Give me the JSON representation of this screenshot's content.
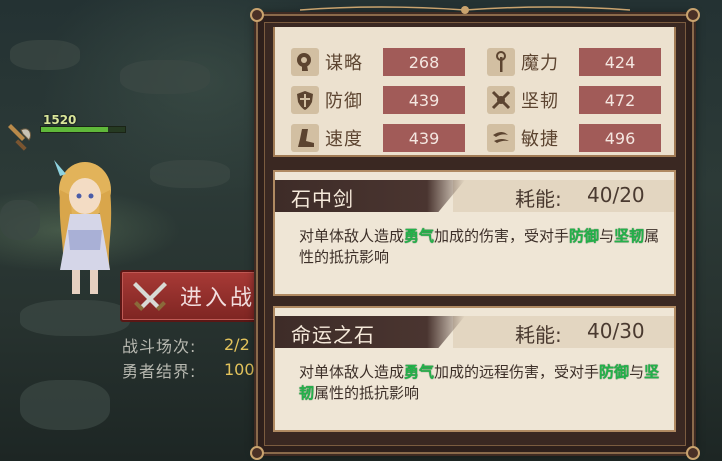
{
  "scene": {
    "hp_value": "1520",
    "hp_ratio": 0.8,
    "enter_button_label": "进入战",
    "battle_info": [
      {
        "label": "战斗场次:",
        "value": "2/2"
      },
      {
        "label": "勇者结界:",
        "value": "100"
      }
    ]
  },
  "stats": [
    {
      "icon": "scroll-head-icon",
      "name": "谋略",
      "value": "268"
    },
    {
      "icon": "staff-icon",
      "name": "魔力",
      "value": "424"
    },
    {
      "icon": "shield-icon",
      "name": "防御",
      "value": "439"
    },
    {
      "icon": "crossed-tools-icon",
      "name": "坚韧",
      "value": "472"
    },
    {
      "icon": "boot-icon",
      "name": "速度",
      "value": "439"
    },
    {
      "icon": "wind-icon",
      "name": "敏捷",
      "value": "496"
    }
  ],
  "skills": [
    {
      "name": "石中剑",
      "energy_label": "耗能:",
      "energy": "40/20",
      "desc_parts": [
        {
          "t": "对单体敌人造成",
          "hl": false
        },
        {
          "t": "勇气",
          "hl": true
        },
        {
          "t": "加成的伤害，受对手",
          "hl": false
        },
        {
          "t": "防御",
          "hl": true
        },
        {
          "t": "与",
          "hl": false
        },
        {
          "t": "坚韧",
          "hl": true
        },
        {
          "t": "属性的抵抗影响",
          "hl": false
        }
      ]
    },
    {
      "name": "命运之石",
      "energy_label": "耗能:",
      "energy": "40/30",
      "desc_parts": [
        {
          "t": "对单体敌人造成",
          "hl": false
        },
        {
          "t": "勇气",
          "hl": true
        },
        {
          "t": "加成的远程伤害，受对手",
          "hl": false
        },
        {
          "t": "防御",
          "hl": true
        },
        {
          "t": "与",
          "hl": false
        },
        {
          "t": "坚韧",
          "hl": true
        },
        {
          "t": "属性的抵抗影响",
          "hl": false
        }
      ]
    }
  ],
  "colors": {
    "highlight": "#23b24a",
    "stat_value_bg": "#a15b58",
    "button_red": "#a83a36",
    "gold_text": "#e3c35c"
  }
}
